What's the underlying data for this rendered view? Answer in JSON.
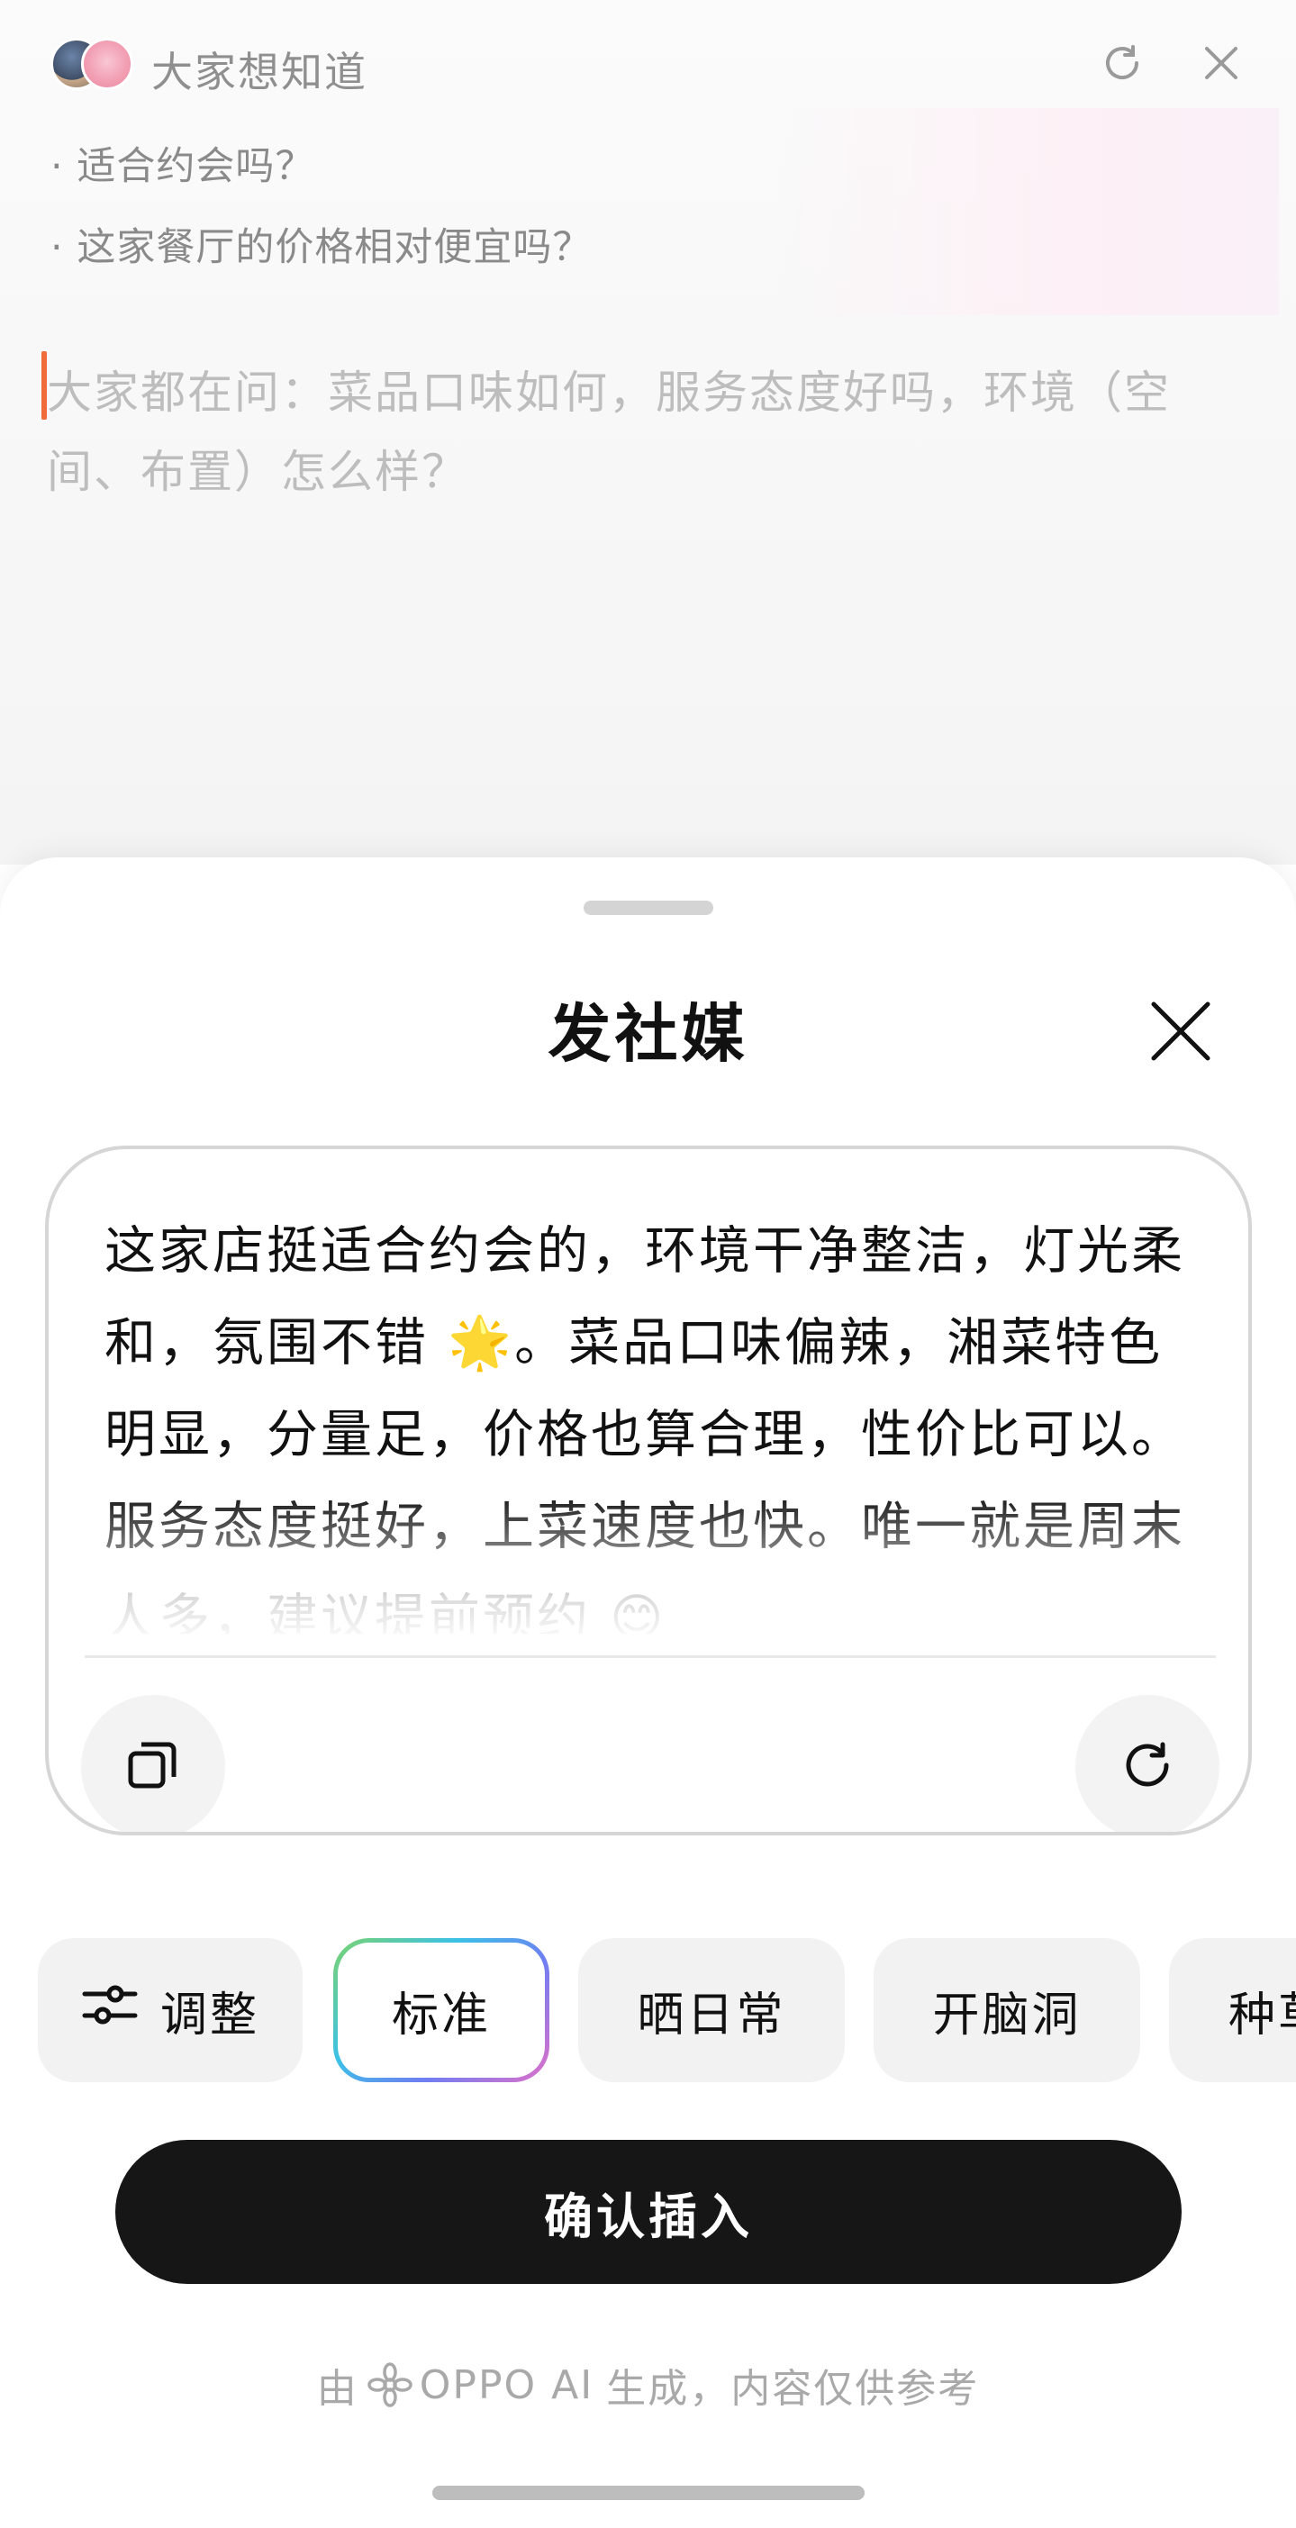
{
  "background": {
    "header_title": "大家想知道",
    "questions": [
      "· 适合约会吗？",
      "· 这家餐厅的价格相对便宜吗？"
    ],
    "input_placeholder": "大家都在问：菜品口味如何，服务态度好吗，环境（空间、布置）怎么样？",
    "icons": [
      "avatar-group",
      "refresh-icon",
      "close-icon"
    ]
  },
  "sheet": {
    "title": "发社媒",
    "generated_text": "这家店挺适合约会的，环境干净整洁，灯光柔和，氛围不错 🌟。菜品口味偏辣，湘菜特色明显，分量足，价格也算合理，性价比可以。服务态度挺好，上菜速度也快。唯一就是周末人多，建议提前预约 😊",
    "icons": [
      "close-icon",
      "copy-icon",
      "regenerate-icon"
    ]
  },
  "chips": {
    "adjust": "调整",
    "items": [
      "标准",
      "晒日常",
      "开脑洞",
      "种草"
    ],
    "selected": "标准"
  },
  "confirm_button": "确认插入",
  "footer": {
    "prefix": "由",
    "brand": "OPPO AI",
    "suffix": "生成，内容仅供参考"
  },
  "colors": {
    "accent_caret": "#f06a3a",
    "confirm_bg": "#161616",
    "chip_bg": "#f2f2f2",
    "selected_chip_gradient": [
      "#7bd36d",
      "#3cc1e6",
      "#6f7ef2",
      "#e070c8"
    ]
  }
}
